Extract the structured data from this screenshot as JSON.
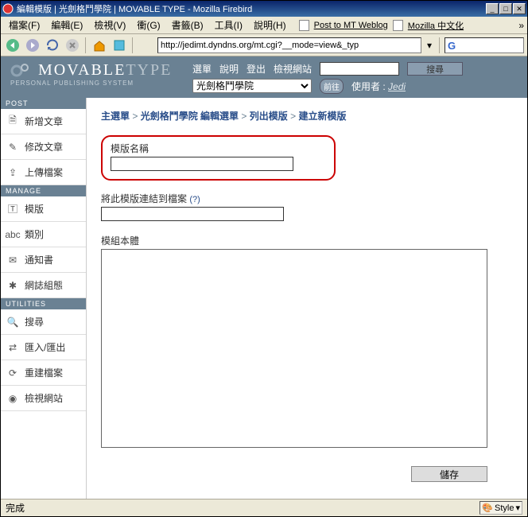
{
  "window": {
    "title": "編輯模版 | 光劍格鬥學院 | MOVABLE TYPE - Mozilla Firebird"
  },
  "menubar": {
    "items": [
      "檔案(F)",
      "編輯(E)",
      "檢視(V)",
      "衝(G)",
      "書籤(B)",
      "工具(I)",
      "說明(H)"
    ],
    "links": [
      "Post to MT Weblog",
      "Mozilla 中文化"
    ]
  },
  "toolbar": {
    "url": "http://jedimt.dyndns.org/mt.cgi?__mode=view&_typ"
  },
  "mt": {
    "brand_left": "MOVABLE",
    "brand_right": "TYPE",
    "sub": "PERSONAL PUBLISHING SYSTEM",
    "nav": {
      "menu": "選單",
      "help": "說明",
      "logout": "登出",
      "viewsite": "檢視網站",
      "search_btn": "搜尋",
      "blog": "光劍格鬥學院",
      "go": "前往",
      "user_label": "使用者 :",
      "user": "Jedi"
    }
  },
  "sidebar": {
    "sections": [
      {
        "head": "POST",
        "items": [
          "新增文章",
          "修改文章",
          "上傳檔案"
        ]
      },
      {
        "head": "MANAGE",
        "items": [
          "模版",
          "類別",
          "通知書",
          "網誌組態"
        ]
      },
      {
        "head": "UTILITIES",
        "items": [
          "搜尋",
          "匯入/匯出",
          "重建檔案",
          "檢視網站"
        ]
      }
    ]
  },
  "breadcrumb": {
    "items": [
      "主選單",
      "光劍格鬥學院 編輯選單",
      "列出模版",
      "建立新模版"
    ],
    "sep": ">"
  },
  "form": {
    "name_label": "模版名稱",
    "link_label": "將此模版連結到檔案",
    "help": "(?)",
    "body_label": "模組本體",
    "save": "儲存"
  },
  "status": {
    "done": "完成",
    "style": "Style"
  }
}
